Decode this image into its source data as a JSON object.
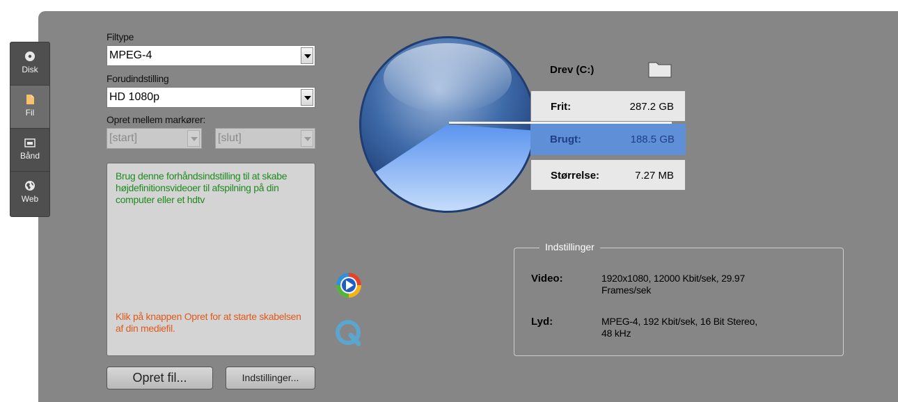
{
  "tabs": [
    {
      "label": "Disk",
      "icon": "disc-icon"
    },
    {
      "label": "Fil",
      "icon": "file-icon",
      "active": true
    },
    {
      "label": "Bånd",
      "icon": "tape-icon"
    },
    {
      "label": "Web",
      "icon": "globe-icon"
    }
  ],
  "form": {
    "filetype_label": "Filtype",
    "filetype_value": "MPEG-4",
    "preset_label": "Forudindstilling",
    "preset_value": "HD 1080p",
    "markers_label": "Opret mellem markører:",
    "start_value": "[start]",
    "end_value": "[slut]"
  },
  "description": {
    "main": "Brug denne forhåndsindstilling til at skabe højdefinitionsvideoer til afspilning på din computer eller et hdtv",
    "hint": "Klik på knappen Opret for at starte skabelsen af din mediefil."
  },
  "buttons": {
    "create_file": "Opret fil...",
    "settings": "Indstillinger..."
  },
  "drive": {
    "label": "Drev (C:)",
    "free_label": "Frit:",
    "free_value": "287.2 GB",
    "used_label": "Brugt:",
    "used_value": "188.5 GB",
    "size_label": "Størrelse:",
    "size_value": "7.27 MB",
    "used_fraction": 0.396
  },
  "settings": {
    "title": "Indstillinger",
    "video_label": "Video:",
    "video_value": "1920x1080, 12000 Kbit/sek, 29.97 Frames/sek",
    "audio_label": "Lyd:",
    "audio_value": "MPEG-4, 192 Kbit/sek, 16 Bit Stereo, 48 kHz"
  },
  "colors": {
    "panel": "#868686",
    "used_blue": "#5f8fd6",
    "desc_green": "#1f8a1f",
    "desc_orange": "#e05a1a"
  }
}
